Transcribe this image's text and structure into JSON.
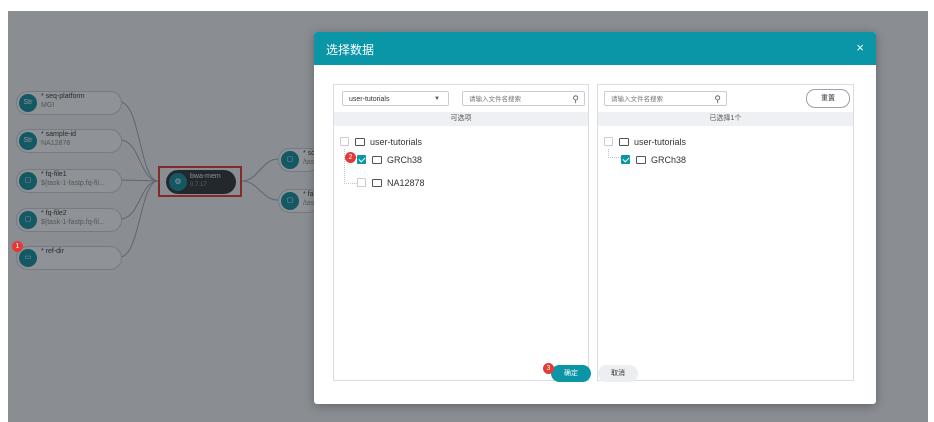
{
  "canvas": {
    "nodes": [
      {
        "title": "* seq-platform",
        "subtitle": "MGI",
        "icon": "Str"
      },
      {
        "title": "* sample-id",
        "subtitle": "NA12878",
        "icon": "Str"
      },
      {
        "title": "* fq-file1",
        "subtitle": "${task-1-fastp.fq-fil...",
        "icon": "file-icon"
      },
      {
        "title": "* fq-file2",
        "subtitle": "${task-1-fastp.fq-fil...",
        "icon": "file-icon"
      },
      {
        "title": "* ref-dir",
        "subtitle": "",
        "icon": "folder-icon"
      }
    ],
    "task": {
      "title": "bwa-mem",
      "version": "0.7.17"
    },
    "outputs": [
      {
        "title": "* so",
        "subtitle": "/tas"
      },
      {
        "title": "* fa",
        "subtitle": "/tas"
      }
    ]
  },
  "badges": [
    "1",
    "2",
    "3"
  ],
  "dialog": {
    "title": "选择数据",
    "close": "×",
    "left_panel": {
      "dropdown_value": "user-tutorials",
      "search_placeholder": "请输入文件名搜索",
      "subheader": "可选项",
      "tree": {
        "root": "user-tutorials",
        "children": [
          {
            "label": "GRCh38",
            "checked": true
          },
          {
            "label": "NA12878",
            "checked": false
          }
        ]
      }
    },
    "right_panel": {
      "search_placeholder": "请输入文件名搜索",
      "reset_label": "重置",
      "subheader": "已选择1个",
      "tree": {
        "root": "user-tutorials",
        "children": [
          {
            "label": "GRCh38",
            "checked": true
          }
        ]
      }
    },
    "confirm_label": "确定",
    "cancel_label": "取消"
  },
  "colors": {
    "accent": "#0b96a8",
    "highlight": "#e0312f",
    "badge": "#e53935"
  }
}
